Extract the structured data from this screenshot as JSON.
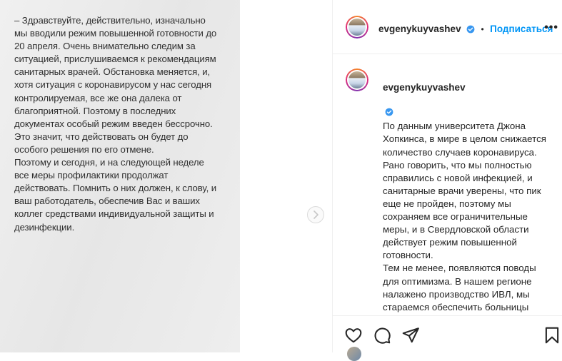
{
  "media": {
    "text": "– Здравствуйте, действительно, изначально\nмы вводили режим повышенной готовности до\n20 апреля. Очень внимательно следим за\nситуацией, прислушиваемся к рекомендациям\nсанитарных врачей. Обстановка меняется, и,\nхотя ситуация с коронавирусом у нас сегодня\nконтролируемая, все же она далека от\nблагоприятной. Поэтому в последних\nдокументах особый режим введен бессрочно.\nЭто значит, что действовать он будет до\nособого решения по его отмене.\nПоэтому и сегодня, и на следующей неделе\nвсе меры профилактики продолжат\nдействовать. Помнить о них должен, к слову, и\nваш работодатель, обеспечив Вас и ваших\nколлег средствами индивидуальной защиты и\nдезинфекции."
  },
  "header": {
    "username": "evgenykuyvashev",
    "separator": "•",
    "follow_label": "Подписаться",
    "more_label": "•••"
  },
  "caption": {
    "username": "evgenykuyvashev",
    "text": "По данным университета Джона Хопкинса, в мире в целом снижается количество случаев коронавируса. Рано говорить, что мы полностью справились с новой инфекцией, и санитарные врачи уверены, что пик еще не пройден, поэтому мы сохраняем все ограничительные меры, и в Свердловской области действует режим повышенной готовности.\nТем не менее, появляются поводы для оптимизма. В нашем регионе налажено производство ИВЛ, мы стараемся обеспечить больницы всеми необходимыми защитными средствами, и самое главное — на сегодняшний день в Свердловской"
  },
  "icons": {
    "next": "chevron-right-icon",
    "verified": "verified-badge-icon",
    "like": "heart-icon",
    "comment": "comment-icon",
    "share": "share-icon",
    "save": "bookmark-icon"
  },
  "colors": {
    "accent": "#0095f6",
    "text": "#262626",
    "media_bg": "#ebebeb"
  }
}
